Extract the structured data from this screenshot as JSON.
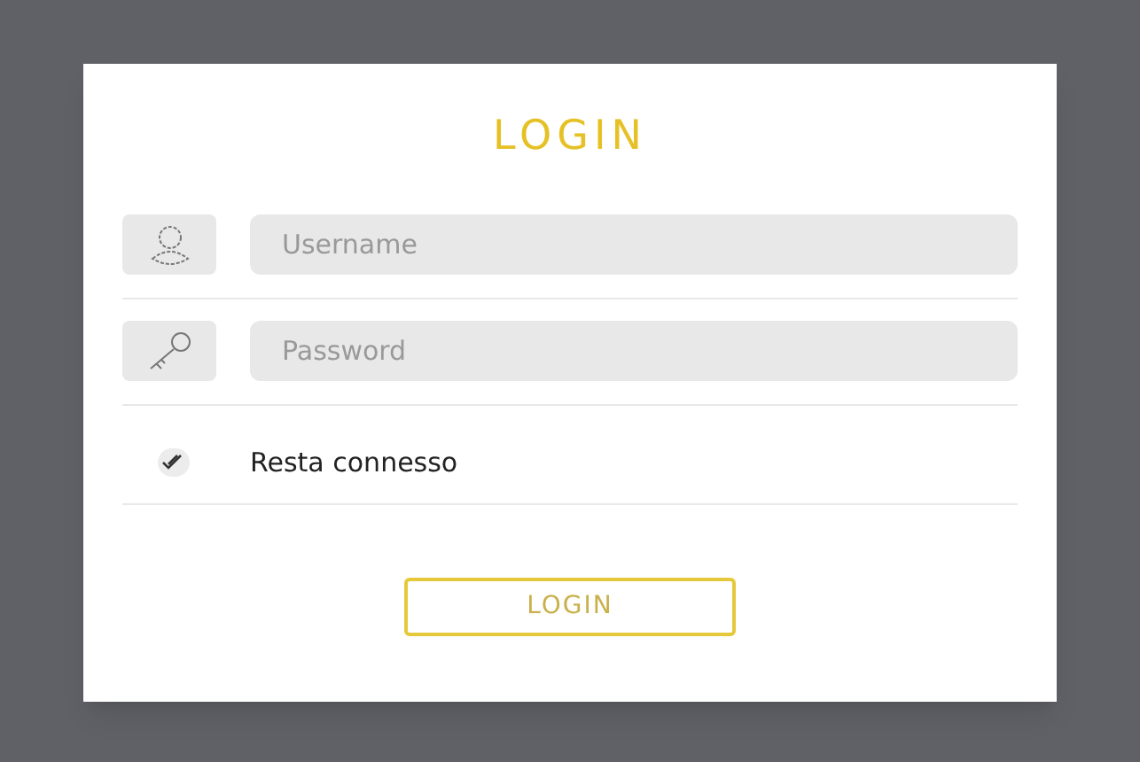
{
  "title": "LOGIN",
  "fields": [
    {
      "kind": "user",
      "placeholder": "Username"
    },
    {
      "kind": "password",
      "placeholder": "Password"
    }
  ],
  "remember": {
    "label": "Resta connesso",
    "checked": true
  },
  "submit": "LOGIN"
}
